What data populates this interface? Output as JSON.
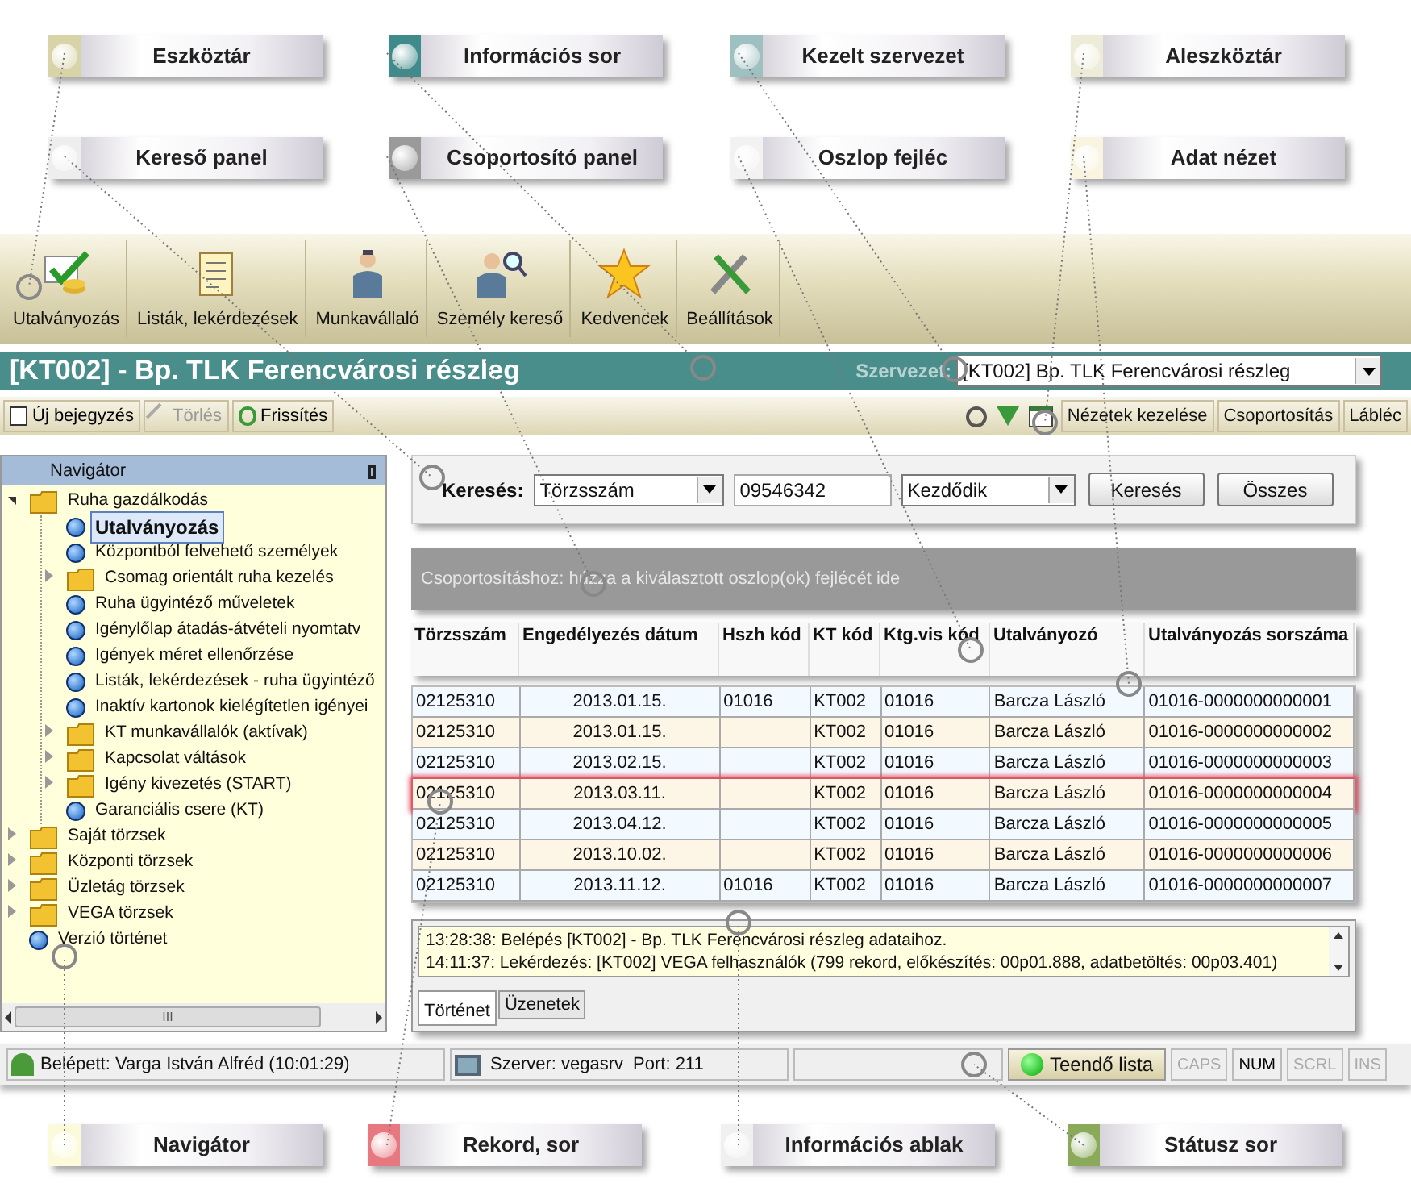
{
  "callouts_top": [
    {
      "label": "Eszköztár",
      "color": "#d8d4a8"
    },
    {
      "label": "Információs sor",
      "color": "#3f8a8a"
    },
    {
      "label": "Kezelt szervezet",
      "color": "#9fc0c0"
    },
    {
      "label": "Aleszköztár",
      "color": "#eeecd8"
    },
    {
      "label": "Kereső panel",
      "color": "#eeeeee"
    },
    {
      "label": "Csoportosító panel",
      "color": "#9a9a9a"
    },
    {
      "label": "Oszlop fejléc",
      "color": "#f2f2f2"
    },
    {
      "label": "Adat nézet",
      "color": "#f8f4e0"
    }
  ],
  "toolbar": {
    "buttons": [
      {
        "label": "Utalványozás"
      },
      {
        "label": "Listák, lekérdezések"
      },
      {
        "label": "Munkavállaló"
      },
      {
        "label": "Személy kereső"
      },
      {
        "label": "Kedvencek"
      },
      {
        "label": "Beállítások"
      }
    ]
  },
  "info_bar": {
    "title": "[KT002] - Bp. TLK Ferencvárosi részleg",
    "org_label": "Szervezet:",
    "org_value": "[KT002] Bp. TLK Ferencvárosi részleg"
  },
  "subtoolbar": {
    "left": [
      {
        "label": "Új bejegyzés",
        "disabled": false
      },
      {
        "label": "Törlés",
        "disabled": true
      },
      {
        "label": "Frissítés",
        "disabled": false
      }
    ],
    "right": [
      {
        "label": "Nézetek kezelése"
      },
      {
        "label": "Csoportosítás"
      },
      {
        "label": "Lábléc"
      }
    ]
  },
  "navigator": {
    "title": "Navigátor",
    "tree": [
      {
        "label": "Ruha gazdálkodás",
        "kind": "folder",
        "expanded": true,
        "selected": false,
        "children": [
          {
            "label": "Utalványozás",
            "kind": "item",
            "selected": true
          },
          {
            "label": "Központból felvehető személyek",
            "kind": "item",
            "selected": false
          },
          {
            "label": "Csomag orientált ruha kezelés",
            "kind": "folder",
            "expanded": false,
            "selected": false
          },
          {
            "label": "Ruha ügyintéző műveletek",
            "kind": "item",
            "selected": false
          },
          {
            "label": "Igénylőlap átadás-átvételi nyomtatv",
            "kind": "item",
            "selected": false
          },
          {
            "label": "Igények méret ellenőrzése",
            "kind": "item",
            "selected": false
          },
          {
            "label": "Listák, lekérdezések - ruha ügyintéző",
            "kind": "item",
            "selected": false
          },
          {
            "label": "Inaktív kartonok kielégítetlen igényei",
            "kind": "item",
            "selected": false
          },
          {
            "label": "KT munkavállalók (aktívak)",
            "kind": "folder",
            "expanded": false,
            "selected": false
          },
          {
            "label": "Kapcsolat váltások",
            "kind": "folder",
            "expanded": false,
            "selected": false
          },
          {
            "label": "Igény kivezetés (START)",
            "kind": "folder",
            "expanded": false,
            "selected": false
          },
          {
            "label": "Garanciális csere (KT)",
            "kind": "item",
            "selected": false
          }
        ]
      },
      {
        "label": "Saját törzsek",
        "kind": "folder",
        "expanded": false,
        "selected": false
      },
      {
        "label": "Központi törzsek",
        "kind": "folder",
        "expanded": false,
        "selected": false
      },
      {
        "label": "Üzletág törzsek",
        "kind": "folder",
        "expanded": false,
        "selected": false
      },
      {
        "label": "VEGA törzsek",
        "kind": "folder",
        "expanded": false,
        "selected": false
      },
      {
        "label": "Verzió történet",
        "kind": "item",
        "selected": false
      }
    ],
    "scrollbar_grip": "III"
  },
  "search": {
    "label": "Keresés:",
    "field": "Törzsszám",
    "value": "09546342",
    "mode": "Kezdődik",
    "buttons": [
      "Keresés",
      "Összes"
    ]
  },
  "group_panel": {
    "hint": "Csoportosításhoz: húzza a kiválasztott oszlop(ok) fejlécét ide"
  },
  "grid": {
    "columns": [
      "Törzsszám",
      "Engedélyezés dátum",
      "Hszh kód",
      "KT kód",
      "Ktg.vis kód",
      "Utalványozó",
      "Utalványozás sorszáma"
    ],
    "rows": [
      {
        "cells": [
          "02125310",
          "2013.01.15.",
          "01016",
          "KT002",
          "01016",
          "Barcza László",
          "01016-0000000000001"
        ],
        "selected": false
      },
      {
        "cells": [
          "02125310",
          "2013.01.15.",
          "",
          "KT002",
          "01016",
          "Barcza László",
          "01016-0000000000002"
        ],
        "selected": false
      },
      {
        "cells": [
          "02125310",
          "2013.02.15.",
          "",
          "KT002",
          "01016",
          "Barcza László",
          "01016-0000000000003"
        ],
        "selected": false
      },
      {
        "cells": [
          "02125310",
          "2013.03.11.",
          "",
          "KT002",
          "01016",
          "Barcza László",
          "01016-0000000000004"
        ],
        "selected": true
      },
      {
        "cells": [
          "02125310",
          "2013.04.12.",
          "",
          "KT002",
          "01016",
          "Barcza László",
          "01016-0000000000005"
        ],
        "selected": false
      },
      {
        "cells": [
          "02125310",
          "2013.10.02.",
          "",
          "KT002",
          "01016",
          "Barcza László",
          "01016-0000000000006"
        ],
        "selected": false
      },
      {
        "cells": [
          "02125310",
          "2013.11.12.",
          "01016",
          "KT002",
          "01016",
          "Barcza László",
          "01016-0000000000007"
        ],
        "selected": false
      }
    ]
  },
  "info_window": {
    "lines": [
      "13:28:38: Belépés [KT002] - Bp. TLK Ferencvárosi részleg adataihoz.",
      "14:11:37: Lekérdezés: [KT002] VEGA felhasználók (799 rekord, előkészítés: 00p01.888, adatbetöltés: 00p03.401)"
    ],
    "tabs": [
      {
        "label": "Történet",
        "selected": true
      },
      {
        "label": "Üzenetek",
        "selected": false
      }
    ]
  },
  "status_bar": {
    "user": "Belépett: Varga István Alfréd (10:01:29)",
    "server": "Szerver: vegasrv",
    "port": "Port: 211",
    "todo": "Teendő lista",
    "indicators": [
      {
        "label": "CAPS",
        "on": false
      },
      {
        "label": "NUM",
        "on": true
      },
      {
        "label": "SCRL",
        "on": false
      },
      {
        "label": "INS",
        "on": false
      }
    ]
  },
  "callouts_bottom": [
    {
      "label": "Navigátor",
      "color": "#fbfbdc"
    },
    {
      "label": "Rekord, sor",
      "color": "#e87880"
    },
    {
      "label": "Információs ablak",
      "color": "#f0f0f0"
    },
    {
      "label": "Státusz sor",
      "color": "#8aaa5a"
    }
  ]
}
